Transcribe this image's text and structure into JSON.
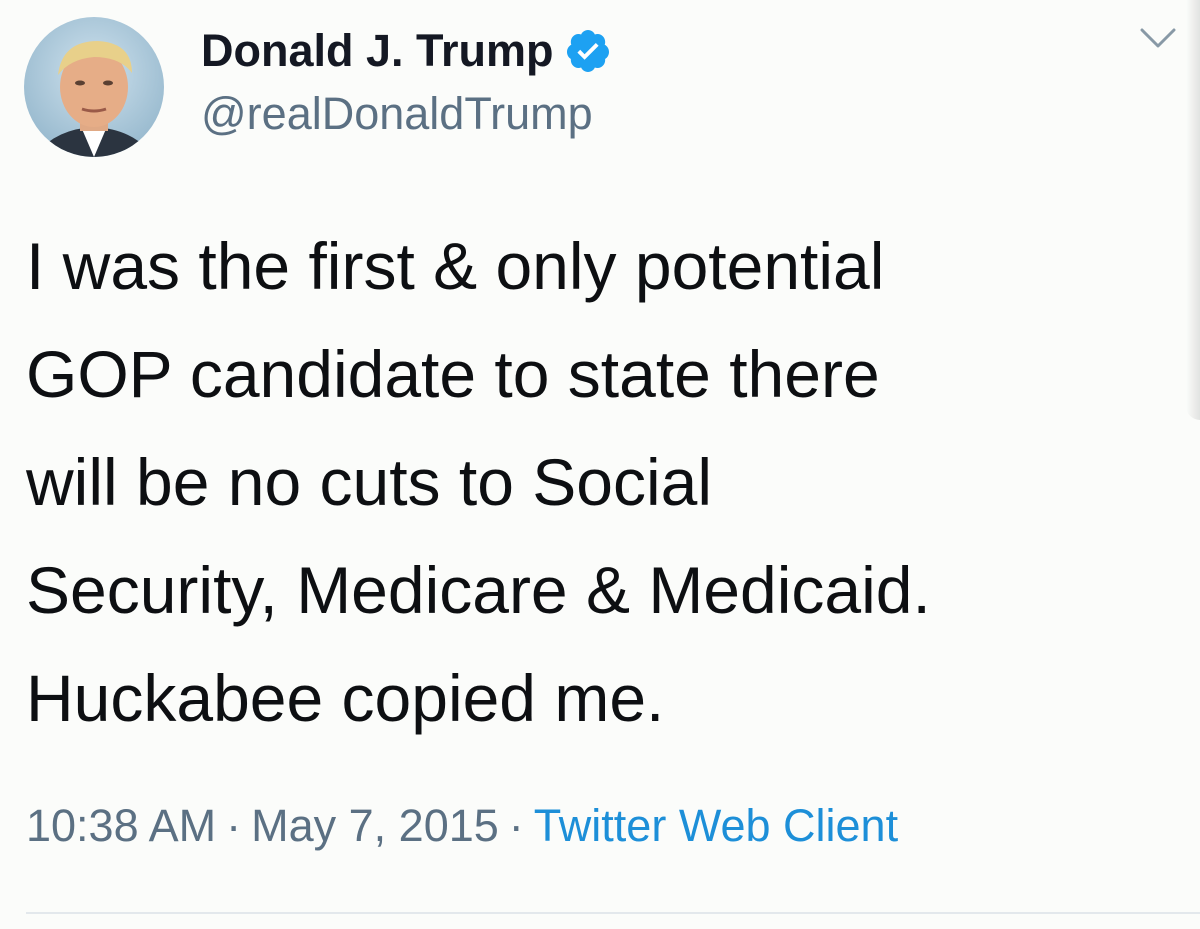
{
  "tweet": {
    "author": {
      "display_name": "Donald J. Trump",
      "handle": "@realDonaldTrump",
      "verified": true,
      "avatar_icon": "profile-photo"
    },
    "text_lines": [
      "I was the first & only potential",
      "GOP candidate to state there",
      "will be no cuts to Social",
      "Security, Medicare & Medicaid.",
      "Huckabee copied me."
    ],
    "time": "10:38 AM",
    "separator_1": "·",
    "date": "May 7, 2015",
    "separator_2": "·",
    "client": "Twitter Web Client",
    "menu_icon": "chevron-down-icon"
  },
  "colors": {
    "verified_badge": "#1da1f2",
    "client_link": "#1d8fd8",
    "secondary_text": "#5b7083"
  }
}
